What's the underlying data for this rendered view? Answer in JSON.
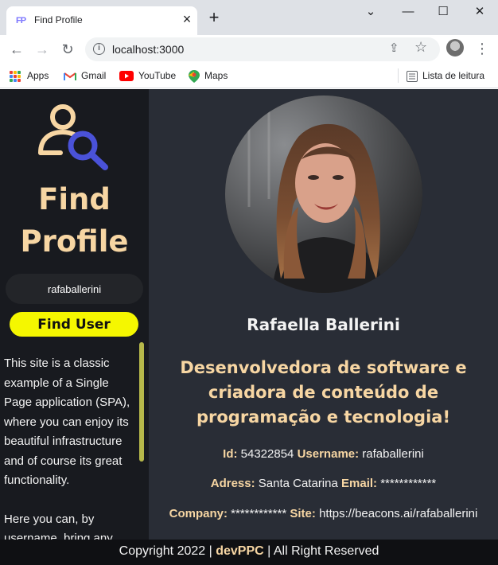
{
  "browser": {
    "tab_title": "Find Profile",
    "tab_favicon": "FP",
    "url": "localhost:3000",
    "bookmarks": [
      {
        "label": "Apps",
        "icon": "apps-grid-icon"
      },
      {
        "label": "Gmail",
        "icon": "gmail-icon"
      },
      {
        "label": "YouTube",
        "icon": "youtube-icon"
      },
      {
        "label": "Maps",
        "icon": "maps-icon"
      }
    ],
    "reading_list": "Lista de leitura"
  },
  "sidebar": {
    "title_line1": "Find",
    "title_line2": "Profile",
    "search_value": "rafaballerini",
    "find_button": "Find User",
    "description_p1": "This site is a classic example of a Single Page application (SPA), where you can enjoy its beautiful infrastructure and of course its great functionality.",
    "description_p2": "Here you can, by username, bring any"
  },
  "profile": {
    "name": "Rafaella Ballerini",
    "bio": "Desenvolvedora de software e criadora de conteúdo de programação e tecnologia!",
    "id_label": "Id:",
    "id_value": "54322854",
    "username_label": "Username:",
    "username_value": "rafaballerini",
    "address_label": "Adress:",
    "address_value": "Santa Catarina",
    "email_label": "Email:",
    "email_value": "************",
    "company_label": "Company:",
    "company_value": "************",
    "site_label": "Site:",
    "site_value": "https://beacons.ai/rafaballerini"
  },
  "footer": {
    "prefix": "Copyright 2022 |",
    "brand": "devPPC",
    "suffix": "| All Right Reserved"
  },
  "colors": {
    "page_bg": "#292d36",
    "sidebar_bg": "#181a1f",
    "accent_peach": "#f7d6a3",
    "button_yellow": "#f5f700",
    "logo_blue": "#4a52d8"
  }
}
